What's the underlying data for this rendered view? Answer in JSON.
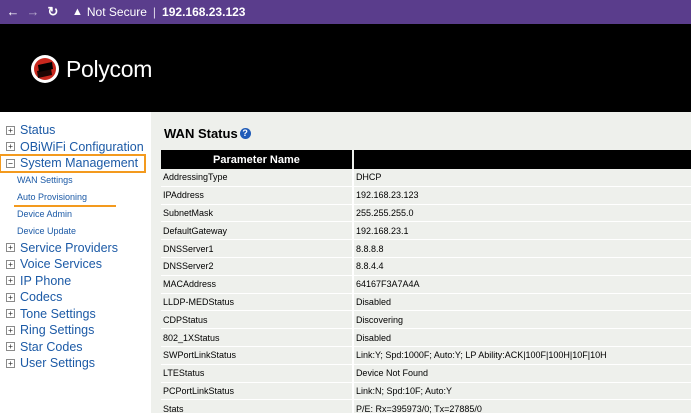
{
  "browser": {
    "security_label": "Not Secure",
    "url": "192.168.23.123",
    "separator": "|"
  },
  "header": {
    "logo_text": "Polycom"
  },
  "sidebar": {
    "items": [
      {
        "label": "Status",
        "icon": "+"
      },
      {
        "label": "OBiWiFi Configuration",
        "icon": "+"
      },
      {
        "label": "System Management",
        "icon": "−",
        "active": true
      },
      {
        "label": "Service Providers",
        "icon": "+"
      },
      {
        "label": "Voice Services",
        "icon": "+"
      },
      {
        "label": "IP Phone",
        "icon": "+"
      },
      {
        "label": "Codecs",
        "icon": "+"
      },
      {
        "label": "Tone Settings",
        "icon": "+"
      },
      {
        "label": "Ring Settings",
        "icon": "+"
      },
      {
        "label": "Star Codes",
        "icon": "+"
      },
      {
        "label": "User Settings",
        "icon": "+"
      }
    ],
    "subitems": [
      {
        "label": "WAN Settings"
      },
      {
        "label": "Auto Provisioning",
        "highlighted": true
      },
      {
        "label": "Device Admin"
      },
      {
        "label": "Device Update"
      }
    ],
    "accent_color": "#f39a1e"
  },
  "main": {
    "title": "WAN Status",
    "table": {
      "headers": [
        "Parameter Name",
        ""
      ],
      "rows": [
        [
          "AddressingType",
          "DHCP"
        ],
        [
          "IPAddress",
          "192.168.23.123"
        ],
        [
          "SubnetMask",
          "255.255.255.0"
        ],
        [
          "DefaultGateway",
          "192.168.23.1"
        ],
        [
          "DNSServer1",
          "8.8.8.8"
        ],
        [
          "DNSServer2",
          "8.8.4.4"
        ],
        [
          "MACAddress",
          "64167F3A7A4A"
        ],
        [
          "LLDP-MEDStatus",
          "Disabled"
        ],
        [
          "CDPStatus",
          "Discovering"
        ],
        [
          "802_1XStatus",
          "Disabled"
        ],
        [
          "SWPortLinkStatus",
          "Link:Y; Spd:1000F; Auto:Y; LP Ability:ACK|100F|100H|10F|10H"
        ],
        [
          "LTEStatus",
          "Device Not Found"
        ],
        [
          "PCPortLinkStatus",
          "Link:N; Spd:10F; Auto:Y"
        ],
        [
          "Stats",
          "P/E: Rx=395973/0; Tx=27885/0"
        ]
      ]
    }
  }
}
